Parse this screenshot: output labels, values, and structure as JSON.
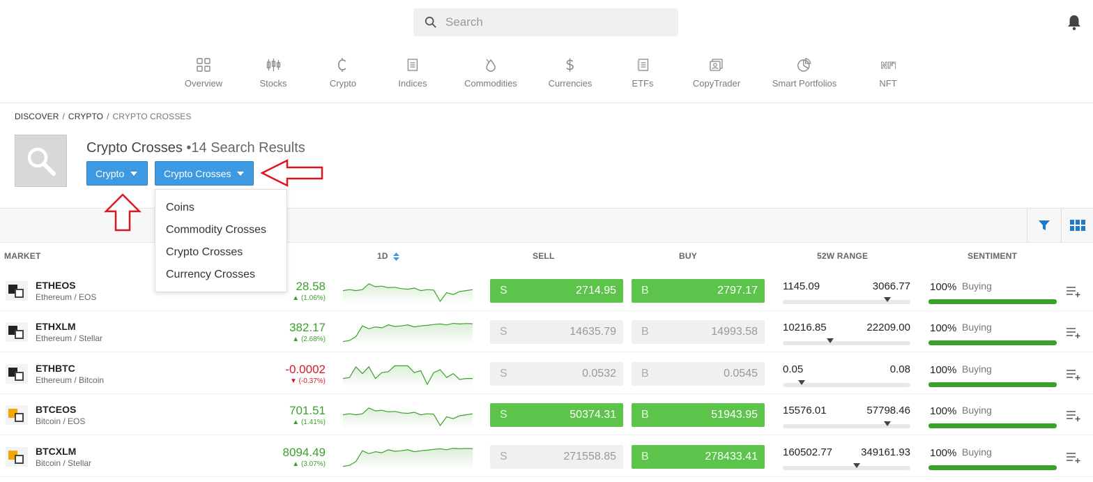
{
  "search": {
    "placeholder": "Search"
  },
  "nav": {
    "items": [
      {
        "label": "Overview",
        "icon": "overview-icon"
      },
      {
        "label": "Stocks",
        "icon": "stocks-icon"
      },
      {
        "label": "Crypto",
        "icon": "crypto-icon"
      },
      {
        "label": "Indices",
        "icon": "indices-icon"
      },
      {
        "label": "Commodities",
        "icon": "commodities-icon"
      },
      {
        "label": "Currencies",
        "icon": "currencies-icon"
      },
      {
        "label": "ETFs",
        "icon": "etfs-icon"
      },
      {
        "label": "CopyTrader",
        "icon": "copytrader-icon"
      },
      {
        "label": "Smart Portfolios",
        "icon": "smart-portfolios-icon"
      },
      {
        "label": "NFT",
        "icon": "nft-icon"
      }
    ]
  },
  "breadcrumb": {
    "items": [
      "DISCOVER",
      "CRYPTO",
      "CRYPTO CROSSES"
    ],
    "separator": "/"
  },
  "header": {
    "title": "Crypto Crosses",
    "bullet": "•",
    "count": "14 Search Results"
  },
  "filters": {
    "category_label": "Crypto",
    "subcategory_label": "Crypto Crosses",
    "menu": [
      "Coins",
      "Commodity Crosses",
      "Crypto Crosses",
      "Currency Crosses"
    ]
  },
  "columns": {
    "market": "MARKET",
    "day": "1D",
    "sell": "SELL",
    "buy": "BUY",
    "range": "52W RANGE",
    "sentiment": "SENTIMENT"
  },
  "colors": {
    "accent": "#3d9ae2",
    "positive": "#3aa12a",
    "negative": "#d31a2c",
    "trade_active": "#5cc44a",
    "annotation_arrow": "#e0141e"
  },
  "rows": [
    {
      "symbol": "ETHEOS",
      "name": "Ethereum / EOS",
      "change": "28.58",
      "pct": "(1.06%)",
      "direction": "up",
      "sell_label": "S",
      "sell": "2714.95",
      "buy_label": "B",
      "buy": "2797.17",
      "active": true,
      "low": "1145.09",
      "high": "3066.77",
      "range_pos": 0.82,
      "sentiment": "100%",
      "sentiment_label": "Buying",
      "sentiment_value": 1.0,
      "spark": [
        0.55,
        0.6,
        0.55,
        0.6,
        0.9,
        0.75,
        0.78,
        0.7,
        0.72,
        0.65,
        0.62,
        0.68,
        0.55,
        0.6,
        0.58,
        0.0,
        0.45,
        0.35,
        0.5,
        0.55,
        0.6
      ]
    },
    {
      "symbol": "ETHXLM",
      "name": "Ethereum / Stellar",
      "change": "382.17",
      "pct": "(2.68%)",
      "direction": "up",
      "sell_label": "S",
      "sell": "14635.79",
      "buy_label": "B",
      "buy": "14993.58",
      "active": false,
      "low": "10216.85",
      "high": "22209.00",
      "range_pos": 0.37,
      "sentiment": "100%",
      "sentiment_label": "Buying",
      "sentiment_value": 1.0,
      "spark": [
        0.05,
        0.1,
        0.3,
        0.85,
        0.7,
        0.8,
        0.75,
        0.9,
        0.82,
        0.85,
        0.9,
        0.8,
        0.85,
        0.88,
        0.92,
        0.95,
        0.9,
        0.98,
        0.95,
        0.97,
        0.96
      ]
    },
    {
      "symbol": "ETHBTC",
      "name": "Ethereum / Bitcoin",
      "change": "-0.0002",
      "pct": "(-0.37%)",
      "direction": "down",
      "sell_label": "S",
      "sell": "0.0532",
      "buy_label": "B",
      "buy": "0.0545",
      "active": false,
      "low": "0.05",
      "high": "0.08",
      "range_pos": 0.15,
      "sentiment": "100%",
      "sentiment_label": "Buying",
      "sentiment_value": 1.0,
      "spark": [
        0.3,
        0.35,
        0.9,
        0.55,
        0.9,
        0.3,
        0.6,
        0.65,
        0.95,
        0.95,
        0.95,
        0.6,
        0.7,
        0.0,
        0.6,
        0.75,
        0.35,
        0.55,
        0.25,
        0.3,
        0.3
      ]
    },
    {
      "symbol": "BTCEOS",
      "name": "Bitcoin / EOS",
      "change": "701.51",
      "pct": "(1.41%)",
      "direction": "up",
      "sell_label": "S",
      "sell": "50374.31",
      "buy_label": "B",
      "buy": "51943.95",
      "active": true,
      "low": "15576.01",
      "high": "57798.46",
      "range_pos": 0.82,
      "sentiment": "100%",
      "sentiment_label": "Buying",
      "sentiment_value": 1.0,
      "spark": [
        0.55,
        0.6,
        0.55,
        0.6,
        0.9,
        0.75,
        0.78,
        0.7,
        0.72,
        0.65,
        0.62,
        0.68,
        0.55,
        0.6,
        0.58,
        0.0,
        0.45,
        0.35,
        0.5,
        0.55,
        0.6
      ]
    },
    {
      "symbol": "BTCXLM",
      "name": "Bitcoin / Stellar",
      "change": "8094.49",
      "pct": "(3.07%)",
      "direction": "up",
      "sell_label": "S",
      "sell": "271558.85",
      "buy_label": "B",
      "buy": "278433.41",
      "active": "buy",
      "low": "160502.77",
      "high": "349161.93",
      "range_pos": 0.58,
      "sentiment": "100%",
      "sentiment_label": "Buying",
      "sentiment_value": 1.0,
      "spark": [
        0.05,
        0.1,
        0.3,
        0.85,
        0.7,
        0.8,
        0.75,
        0.9,
        0.82,
        0.85,
        0.9,
        0.8,
        0.85,
        0.88,
        0.92,
        0.95,
        0.9,
        0.98,
        0.95,
        0.97,
        0.96
      ]
    }
  ]
}
